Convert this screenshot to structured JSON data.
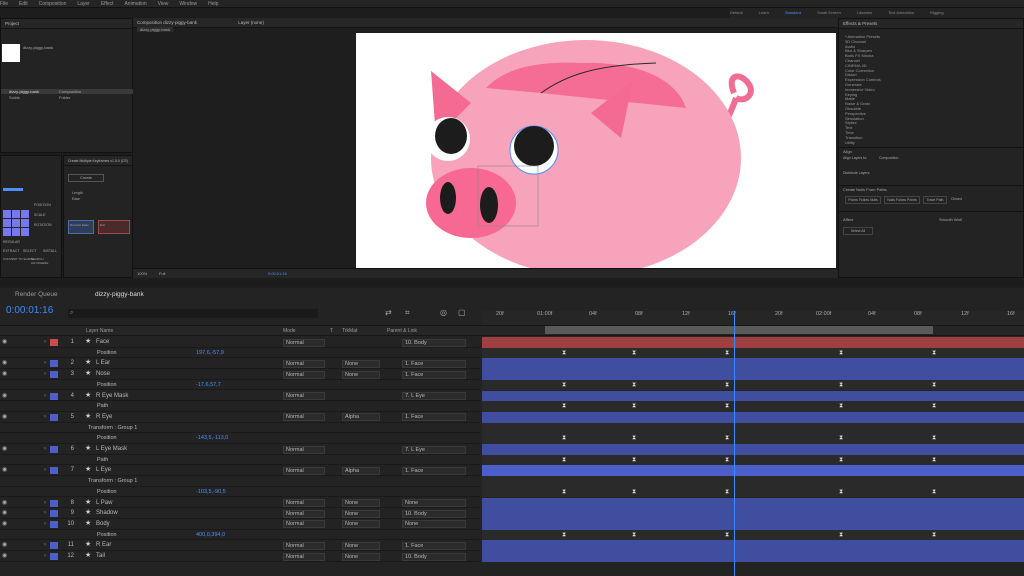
{
  "menu": [
    "File",
    "Edit",
    "Composition",
    "Layer",
    "Effect",
    "Animation",
    "View",
    "Window",
    "Help"
  ],
  "workspaces": {
    "items": [
      "Default",
      "Learn",
      "Standard",
      "Small Screen",
      "Libraries",
      "Text Animation",
      "Rigging"
    ],
    "active": "Standard"
  },
  "project": {
    "tab": "Project",
    "item_name": "dizzy-piggy-bank",
    "rows": [
      {
        "name": "dizzy-piggy-bank",
        "type": "Composition"
      },
      {
        "name": "Solids",
        "type": "Folder"
      }
    ]
  },
  "viewer": {
    "tab": "Composition dizzy-piggy-bank",
    "tab2": "Layer (none)",
    "crumb": "dizzy-piggy-bank",
    "zoom": "100%",
    "res": "Full",
    "time": "0:00:01:16"
  },
  "effects": {
    "title": "Effects & Presets",
    "search_placeholder": "",
    "items": [
      "* Animation Presets",
      "3D Channel",
      "Audio",
      "Blur & Sharpen",
      "Boris FX Mocha",
      "Channel",
      "CINEMA 4D",
      "Color Correction",
      "Distort",
      "Expression Controls",
      "Generate",
      "Immersive Video",
      "Keying",
      "Matte",
      "Noise & Grain",
      "Obsolete",
      "Perspective",
      "Simulation",
      "Stylize",
      "Text",
      "Time",
      "Transition",
      "Utility"
    ]
  },
  "align": {
    "title": "Align",
    "label": "Align Layers to:",
    "target": "Composition",
    "dist_label": "Distribute Layers:"
  },
  "shapes_panel": {
    "title": "Create Nulls From Paths",
    "buttons": [
      "Points Follow Nulls",
      "Nulls Follow Points",
      "Trace Path"
    ],
    "loop": "Closed"
  },
  "bottom_panels": {
    "affect": "Affect",
    "affect_value": "Select All",
    "smooth": "Smooth Wait"
  },
  "duik": {
    "labels": [
      "REGULAR",
      "EXTRACT",
      "SELECT",
      "INSTALL",
      "CONVERT TO SHAPE",
      "SEARCH ANYWHERE",
      "POSITION",
      "SCALE",
      "ROTATION"
    ]
  },
  "keyframe_panel": {
    "title": "Create Multiple Keyframes v1.0.0 (CS)",
    "btn": "Create",
    "lbl1": "Length",
    "lbl2": "Ease",
    "btn2": "Reverse Ease",
    "btn3": "Exit"
  },
  "timeline": {
    "tab_render": "Render Queue",
    "tab_comp": "dizzy-piggy-bank",
    "timecode": "0:00:01:16",
    "search_placeholder": "",
    "columns": {
      "layer": "Layer Name",
      "mode": "Mode",
      "t": "T",
      "trkmat": "TrkMat",
      "parent": "Parent & Link"
    },
    "ruler": [
      "20f",
      "01:00f",
      "04f",
      "08f",
      "12f",
      "16f",
      "20f",
      "02:00f",
      "04f",
      "08f",
      "12f",
      "16f"
    ]
  },
  "layers": [
    {
      "n": "1",
      "name": "Face",
      "mode": "Normal",
      "trk": "",
      "parent": "10. Body",
      "type": "layer",
      "color": "#c94b4b"
    },
    {
      "n": "",
      "name": "Position",
      "val": "197,6,-57,9",
      "type": "prop"
    },
    {
      "n": "2",
      "name": "L Ear",
      "mode": "Normal",
      "trk": "None",
      "parent": "1. Face",
      "type": "layer",
      "color": "#4b5ec9"
    },
    {
      "n": "3",
      "name": "Nose",
      "mode": "Normal",
      "trk": "None",
      "parent": "1. Face",
      "type": "layer",
      "color": "#4b5ec9"
    },
    {
      "n": "",
      "name": "Position",
      "val": "-17,6,57,7",
      "type": "prop"
    },
    {
      "n": "4",
      "name": "R Eye Mask",
      "mode": "Normal",
      "trk": "",
      "parent": "7. L Eye",
      "type": "layer",
      "color": "#4b5ec9"
    },
    {
      "n": "",
      "name": "Path",
      "val": "",
      "type": "prop"
    },
    {
      "n": "5",
      "name": "R Eye",
      "mode": "Normal",
      "trk": "Alpha",
      "parent": "1. Face",
      "type": "layer",
      "color": "#4b5ec9"
    },
    {
      "n": "",
      "name": "Transform : Group 1",
      "val": "",
      "type": "group"
    },
    {
      "n": "",
      "name": "Position",
      "val": "-143,5,-113,0",
      "type": "prop"
    },
    {
      "n": "6",
      "name": "L Eye Mask",
      "mode": "Normal",
      "trk": "",
      "parent": "7. L Eye",
      "type": "layer",
      "color": "#4b5ec9"
    },
    {
      "n": "",
      "name": "Path",
      "val": "",
      "type": "prop"
    },
    {
      "n": "7",
      "name": "L Eye",
      "mode": "Normal",
      "trk": "Alpha",
      "parent": "1. Face",
      "type": "layer",
      "color": "#4b5ec9"
    },
    {
      "n": "",
      "name": "Transform : Group 1",
      "val": "",
      "type": "group"
    },
    {
      "n": "",
      "name": "Position",
      "val": "-103,5,-90,5",
      "type": "prop"
    },
    {
      "n": "8",
      "name": "L Paw",
      "mode": "Normal",
      "trk": "None",
      "parent": "None",
      "type": "layer",
      "color": "#4b5ec9"
    },
    {
      "n": "9",
      "name": "Shadow",
      "mode": "Normal",
      "trk": "None",
      "parent": "10. Body",
      "type": "layer",
      "color": "#4b5ec9"
    },
    {
      "n": "10",
      "name": "Body",
      "mode": "Normal",
      "trk": "None",
      "parent": "None",
      "type": "layer",
      "color": "#4b5ec9"
    },
    {
      "n": "",
      "name": "Position",
      "val": "400,0,394,0",
      "type": "prop"
    },
    {
      "n": "11",
      "name": "R Ear",
      "mode": "Normal",
      "trk": "None",
      "parent": "1. Face",
      "type": "layer",
      "color": "#4b5ec9"
    },
    {
      "n": "12",
      "name": "Tail",
      "mode": "Normal",
      "trk": "None",
      "parent": "10. Body",
      "type": "layer",
      "color": "#4b5ec9"
    }
  ]
}
